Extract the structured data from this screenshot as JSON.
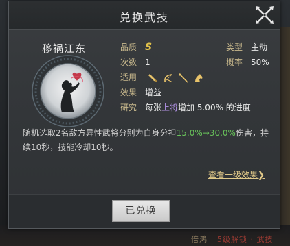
{
  "dialog": {
    "title": "兑换武技",
    "close_icon": "crossed-swords-close-icon"
  },
  "skill": {
    "name": "移祸江东",
    "portrait_icon": "dancer-heart-portrait-icon"
  },
  "stats": {
    "quality_label": "品质",
    "quality_value": "S",
    "type_label": "类型",
    "type_value": "主动",
    "count_label": "次数",
    "count_value": "1",
    "rate_label": "概率",
    "rate_value": "50%",
    "applicable_label": "适用",
    "applicable_icons": [
      "sword-icon",
      "bow-icon",
      "spear-icon",
      "horse-icon"
    ],
    "effect_label": "效果",
    "effect_value": "增益",
    "research_label": "研究",
    "research_prefix": "每张",
    "research_highlight": "上将",
    "research_suffix": "增加 5.00% 的进度"
  },
  "description": {
    "part1": "随机选取2名敌方异性武将分别为自身分担",
    "range": "15.0%→30.0%",
    "part2": "伤害，持续10秒，技能冷却10秒。"
  },
  "more_link": "查看一级效果❯",
  "redeem_button": "已兑换",
  "background": {
    "bottom_text": "倍鸿",
    "bottom_red": "5级解锁 · 武技"
  },
  "colors": {
    "label": "#c9b98d",
    "quality": "#e0c04a",
    "highlight": "#b493e8",
    "green": "#68c25a",
    "link": "#e0c989"
  }
}
